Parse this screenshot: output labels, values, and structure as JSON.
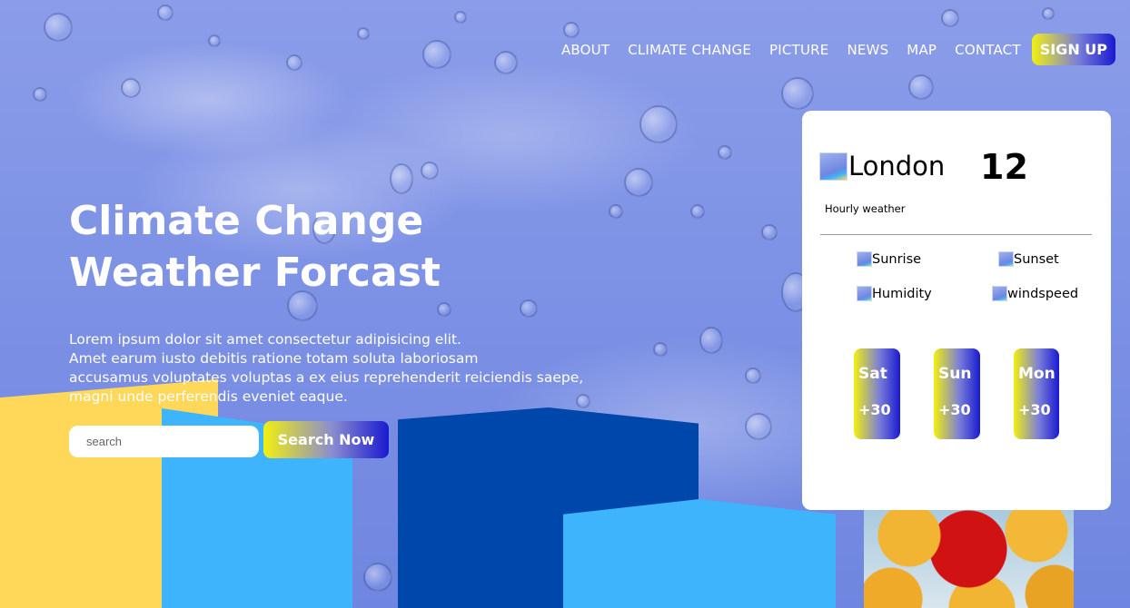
{
  "nav": {
    "links": [
      "ABOUT",
      "CLIMATE CHANGE",
      "PICTURE",
      "NEWS",
      "MAP",
      "CONTACT"
    ],
    "signup_label": "SIGN UP"
  },
  "hero": {
    "title_line1": "Climate Change",
    "title_line2": "Weather Forcast",
    "desc_line1": "Lorem ipsum dolor sit amet consectetur adipisicing elit.",
    "desc_line2": "Amet earum iusto debitis ratione totam soluta laboriosam",
    "desc_line3": "accusamus voluptates voluptas a ex eius reprehenderit reiciendis saepe,",
    "desc_line4": "magni unde perferendis eveniet eaque."
  },
  "search": {
    "placeholder": "search",
    "button_label": "Search Now"
  },
  "weather": {
    "city": "London",
    "temperature": "12",
    "hourly_label": "Hourly weather",
    "stats": {
      "sunrise": "Sunrise",
      "sunset": "Sunset",
      "humidity": "Humidity",
      "windspeed": "windspeed"
    },
    "days": [
      {
        "name": "Sat",
        "temp": "+30"
      },
      {
        "name": "Sun",
        "temp": "+30"
      },
      {
        "name": "Mon",
        "temp": "+30"
      }
    ]
  },
  "colors": {
    "background": "#7f93e6",
    "gradient_start": "#f2ef10",
    "gradient_end": "#1a1ad0",
    "yellow_block": "#ffd85a",
    "light_blue_block": "#3db4fb",
    "dark_blue_block": "#0047ab"
  }
}
